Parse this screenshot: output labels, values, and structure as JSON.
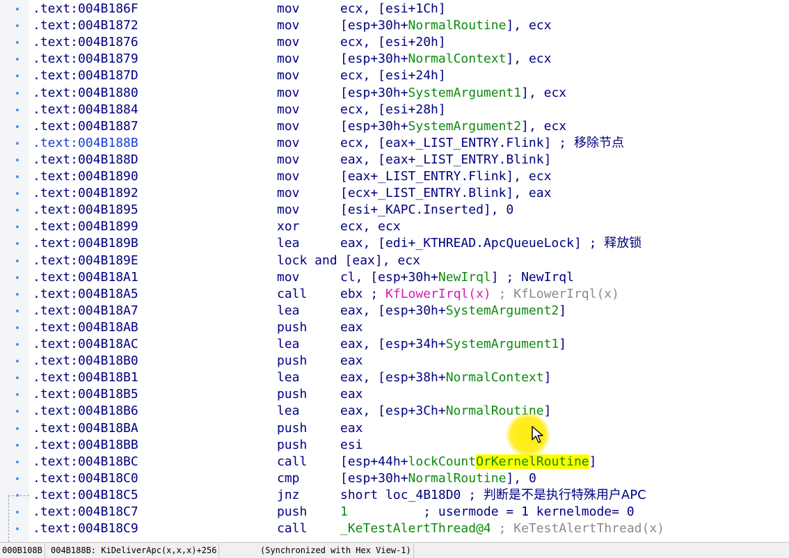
{
  "listing": {
    "rows": [
      {
        "addr": ".text:004B186F",
        "mnem": "mov",
        "ops": [
          {
            "t": "ecx, [esi+1Ch]"
          }
        ]
      },
      {
        "addr": ".text:004B1872",
        "mnem": "mov",
        "ops": [
          {
            "t": "[esp+30h+"
          },
          {
            "t": "NormalRoutine",
            "c": "g"
          },
          {
            "t": "], ecx"
          }
        ]
      },
      {
        "addr": ".text:004B1876",
        "mnem": "mov",
        "ops": [
          {
            "t": "ecx, [esi+20h]"
          }
        ]
      },
      {
        "addr": ".text:004B1879",
        "mnem": "mov",
        "ops": [
          {
            "t": "[esp+30h+"
          },
          {
            "t": "NormalContext",
            "c": "g"
          },
          {
            "t": "], ecx"
          }
        ]
      },
      {
        "addr": ".text:004B187D",
        "mnem": "mov",
        "ops": [
          {
            "t": "ecx, [esi+24h]"
          }
        ]
      },
      {
        "addr": ".text:004B1880",
        "mnem": "mov",
        "ops": [
          {
            "t": "[esp+30h+"
          },
          {
            "t": "SystemArgument1",
            "c": "g"
          },
          {
            "t": "], ecx"
          }
        ]
      },
      {
        "addr": ".text:004B1884",
        "mnem": "mov",
        "ops": [
          {
            "t": "ecx, [esi+28h]"
          }
        ]
      },
      {
        "addr": ".text:004B1887",
        "mnem": "mov",
        "ops": [
          {
            "t": "[esp+30h+"
          },
          {
            "t": "SystemArgument2",
            "c": "g"
          },
          {
            "t": "], ecx"
          }
        ]
      },
      {
        "addr": ".text:004B188B",
        "addr_current": true,
        "mnem": "mov",
        "ops": [
          {
            "t": "ecx, [eax+_LIST_ENTRY.Flink] ; "
          },
          {
            "t": "移除节点",
            "c": "zh"
          }
        ]
      },
      {
        "addr": ".text:004B188D",
        "mnem": "mov",
        "ops": [
          {
            "t": "eax, [eax+_LIST_ENTRY.Blink]"
          }
        ]
      },
      {
        "addr": ".text:004B1890",
        "mnem": "mov",
        "ops": [
          {
            "t": "[eax+_LIST_ENTRY.Flink], ecx"
          }
        ]
      },
      {
        "addr": ".text:004B1892",
        "mnem": "mov",
        "ops": [
          {
            "t": "[ecx+_LIST_ENTRY.Blink], eax"
          }
        ]
      },
      {
        "addr": ".text:004B1895",
        "mnem": "mov",
        "ops": [
          {
            "t": "[esi+_KAPC.Inserted], 0"
          }
        ]
      },
      {
        "addr": ".text:004B1899",
        "mnem": "xor",
        "ops": [
          {
            "t": "ecx, ecx"
          }
        ]
      },
      {
        "addr": ".text:004B189B",
        "mnem": "lea",
        "ops": [
          {
            "t": "eax, [edi+_KTHREAD.ApcQueueLock] ; "
          },
          {
            "t": "释放锁",
            "c": "zh"
          }
        ]
      },
      {
        "addr": ".text:004B189E",
        "mnem": "lock and [eax], ecx",
        "ops": []
      },
      {
        "addr": ".text:004B18A1",
        "mnem": "mov",
        "ops": [
          {
            "t": "cl, [esp+30h+"
          },
          {
            "t": "NewIrql",
            "c": "g"
          },
          {
            "t": "] ; NewIrql"
          }
        ]
      },
      {
        "addr": ".text:004B18A5",
        "mnem": "call",
        "ops": [
          {
            "t": "ebx ; "
          },
          {
            "t": "KfLowerIrql(x)",
            "c": "p"
          },
          {
            "t": " ; KfLowerIrql(x)",
            "c": "gray"
          }
        ]
      },
      {
        "addr": ".text:004B18A7",
        "mnem": "lea",
        "ops": [
          {
            "t": "eax, [esp+30h+"
          },
          {
            "t": "SystemArgument2",
            "c": "g"
          },
          {
            "t": "]"
          }
        ]
      },
      {
        "addr": ".text:004B18AB",
        "mnem": "push",
        "ops": [
          {
            "t": "eax"
          }
        ]
      },
      {
        "addr": ".text:004B18AC",
        "mnem": "lea",
        "ops": [
          {
            "t": "eax, [esp+34h+"
          },
          {
            "t": "SystemArgument1",
            "c": "g"
          },
          {
            "t": "]"
          }
        ]
      },
      {
        "addr": ".text:004B18B0",
        "mnem": "push",
        "ops": [
          {
            "t": "eax"
          }
        ]
      },
      {
        "addr": ".text:004B18B1",
        "mnem": "lea",
        "ops": [
          {
            "t": "eax, [esp+38h+"
          },
          {
            "t": "NormalContext",
            "c": "g"
          },
          {
            "t": "]"
          }
        ]
      },
      {
        "addr": ".text:004B18B5",
        "mnem": "push",
        "ops": [
          {
            "t": "eax"
          }
        ]
      },
      {
        "addr": ".text:004B18B6",
        "mnem": "lea",
        "ops": [
          {
            "t": "eax, [esp+3Ch+"
          },
          {
            "t": "NormalRoutine",
            "c": "g"
          },
          {
            "t": "]"
          }
        ]
      },
      {
        "addr": ".text:004B18BA",
        "mnem": "push",
        "ops": [
          {
            "t": "eax"
          }
        ]
      },
      {
        "addr": ".text:004B18BB",
        "mnem": "push",
        "ops": [
          {
            "t": "esi"
          }
        ]
      },
      {
        "addr": ".text:004B18BC",
        "mnem": "call",
        "ops": [
          {
            "t": "[esp+44h+"
          },
          {
            "t": "lockCount",
            "c": "g"
          },
          {
            "t": "OrKernelRoutine",
            "c": "g hl"
          },
          {
            "t": "]"
          }
        ]
      },
      {
        "addr": ".text:004B18C0",
        "mnem": "cmp",
        "ops": [
          {
            "t": "[esp+30h+"
          },
          {
            "t": "NormalRoutine",
            "c": "g"
          },
          {
            "t": "], 0"
          }
        ]
      },
      {
        "addr": ".text:004B18C5",
        "mnem": "jnz",
        "ops": [
          {
            "t": "short loc_4B18D0 ; "
          },
          {
            "t": "判断是不是执行特殊用户APC",
            "c": "zh"
          }
        ]
      },
      {
        "addr": ".text:004B18C7",
        "mnem": "push",
        "ops": [
          {
            "t": "1",
            "c": "g"
          },
          {
            "t": "          ; usermode = 1 kernelmode= 0"
          }
        ]
      },
      {
        "addr": ".text:004B18C9",
        "mnem": "call",
        "ops": [
          {
            "t": "_KeTestAlertThread@4",
            "c": "g"
          },
          {
            "t": " ; KeTestAlertThread(x)",
            "c": "gray"
          }
        ]
      }
    ]
  },
  "status_bar": {
    "file_offset": "000B108B",
    "location": "004B188B: KiDeliverApc(x,x,x)+256",
    "sync": "(Synchronized with Hex View-1)"
  },
  "colors": {
    "code": "#000080",
    "name": "#0c8a0c",
    "import": "#d21bb3",
    "auto_comment": "#8a8a8a",
    "highlight": "#ffff00",
    "gutter_dot": "#4a90e2"
  },
  "icons": {
    "cursor": "mouse-pointer-icon"
  }
}
